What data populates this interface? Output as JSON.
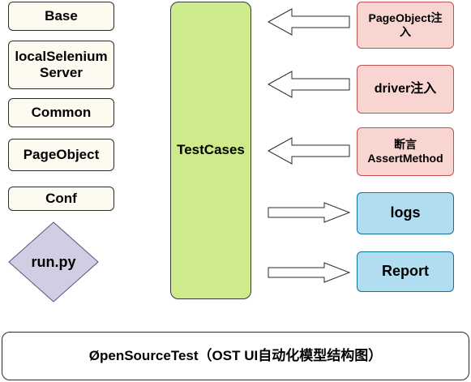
{
  "left_components": {
    "base": "Base",
    "local_selenium_line1": "localSelenium",
    "local_selenium_line2": "Server",
    "common": "Common",
    "page_object": "PageObject",
    "conf": "Conf",
    "run_py": "run.py"
  },
  "center": {
    "test_cases": "TestCases"
  },
  "right_inputs": {
    "page_object_inject_line1": "PageObject注",
    "page_object_inject_line2": "入",
    "driver_inject": "driver注入",
    "assert_line1": "断言",
    "assert_line2": "AssertMethod"
  },
  "right_outputs": {
    "logs": "logs",
    "report": "Report"
  },
  "footer": {
    "caption": "ØpenSourceTest（OST UI自动化模型结构图）"
  },
  "colors": {
    "left_fill": "#fdfbf0",
    "testcases_fill": "#cdeb8b",
    "inject_fill": "#f9d5d2",
    "inject_border": "#c0504d",
    "output_fill": "#b1ddf0",
    "output_border": "#10739e",
    "diamond_fill": "#d0cee2",
    "diamond_border": "#56517e"
  },
  "icons": {
    "inbound_arrow": "left-block-arrow",
    "outbound_arrow": "right-block-arrow"
  }
}
